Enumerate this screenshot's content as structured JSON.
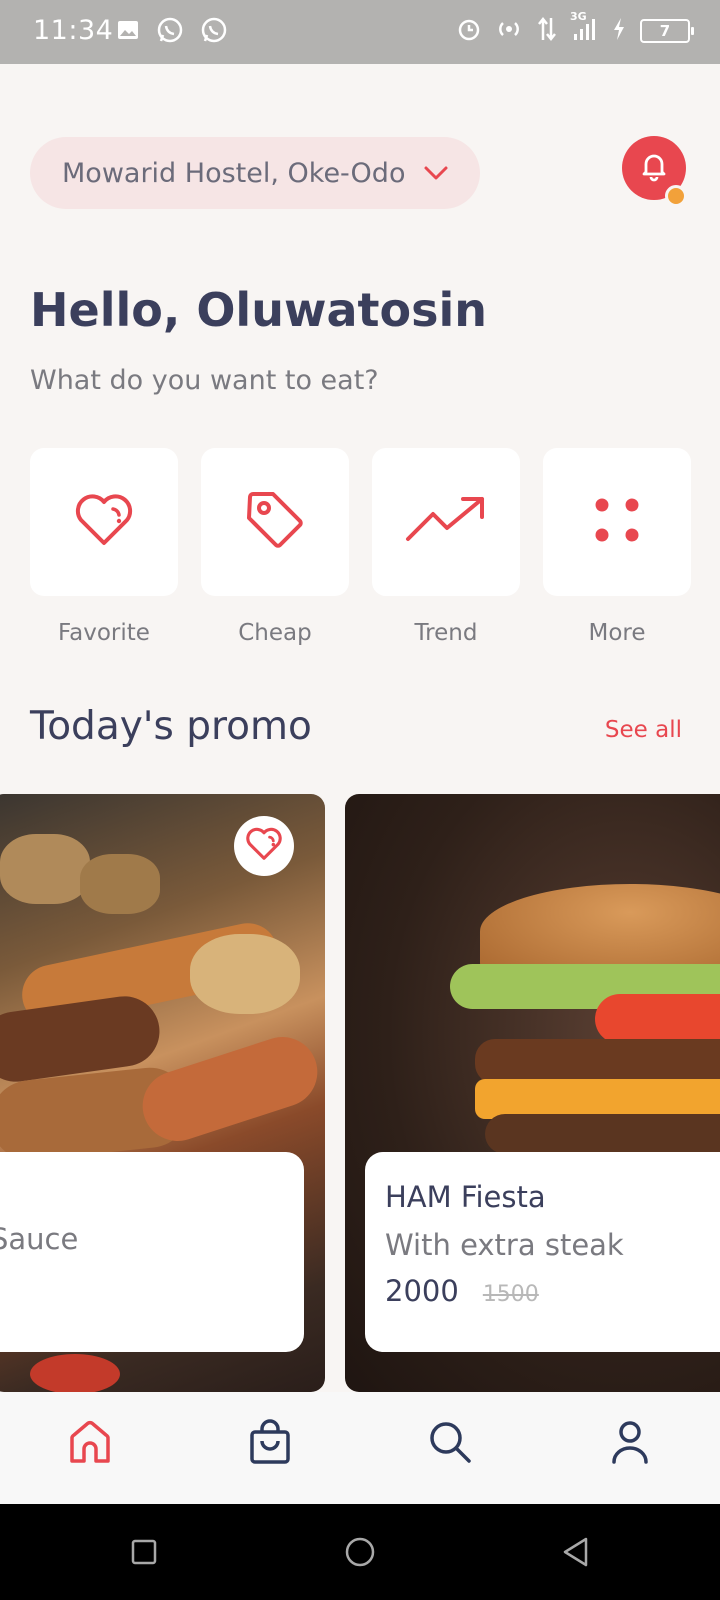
{
  "status_bar": {
    "time": "11:34",
    "network": "3G",
    "battery": "7",
    "icons": [
      "gallery-icon",
      "whatsapp-icon",
      "whatsapp-icon",
      "alarm-icon",
      "hotspot-icon",
      "data-transfer-icon",
      "signal-icon",
      "charging-icon",
      "battery-icon"
    ]
  },
  "header": {
    "location": "Mowarid Hostel, Oke-Odo",
    "location_icon": "chevron-down-icon",
    "notification_icon": "bell-icon"
  },
  "greeting": {
    "title": "Hello, Oluwatosin",
    "subtitle": "What do you want to eat?"
  },
  "categories": [
    {
      "label": "Favorite",
      "icon": "heart-icon"
    },
    {
      "label": "Cheap",
      "icon": "tag-icon"
    },
    {
      "label": "Trend",
      "icon": "trending-up-icon"
    },
    {
      "label": "More",
      "icon": "grid-dots-icon"
    }
  ],
  "promo": {
    "title": "Today's promo",
    "see_all": "See all",
    "cards": [
      {
        "desc": "Sauce",
        "favorite": true
      },
      {
        "name": "HAM Fiesta",
        "desc": "With extra steak",
        "price": "2000",
        "old_price": "1500"
      }
    ]
  },
  "bottom_nav": [
    {
      "icon": "home-icon",
      "active": true
    },
    {
      "icon": "shopping-bag-icon",
      "active": false
    },
    {
      "icon": "search-icon",
      "active": false
    },
    {
      "icon": "profile-icon",
      "active": false
    }
  ],
  "colors": {
    "accent": "#e8474f",
    "text_dark": "#3b3f5c",
    "text_muted": "#7a7a80",
    "background": "#f8f5f3",
    "pill_bg": "#f6e5e5",
    "badge": "#f2a13a"
  }
}
